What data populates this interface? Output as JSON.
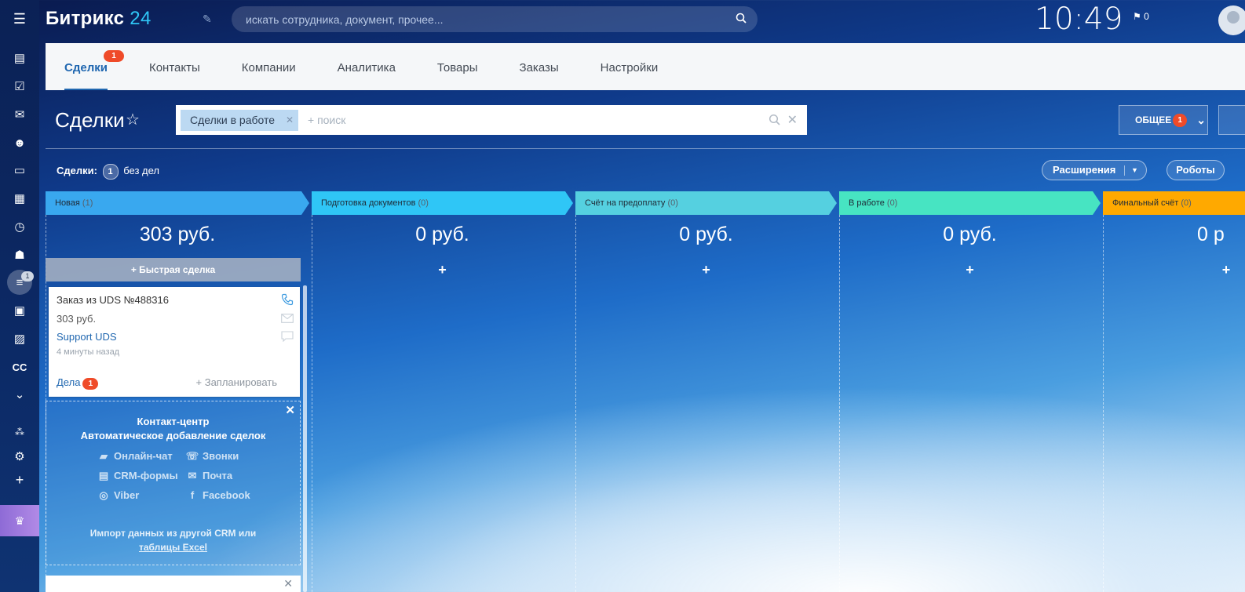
{
  "app": {
    "logo_text": "Битрикс",
    "logo_num": "24"
  },
  "header": {
    "search_placeholder": "искать сотрудника, документ, прочее...",
    "clock": "10:49",
    "notifications": "0"
  },
  "left_rail": {
    "active_badge": "1"
  },
  "tabs": [
    {
      "label": "Сделки",
      "badge": "1"
    },
    {
      "label": "Контакты"
    },
    {
      "label": "Компании"
    },
    {
      "label": "Аналитика"
    },
    {
      "label": "Товары"
    },
    {
      "label": "Заказы"
    },
    {
      "label": "Настройки"
    }
  ],
  "page": {
    "title": "Сделки",
    "filter_chip": "Сделки в работе",
    "filter_add": "+ поиск",
    "general_btn": "ОБЩЕЕ",
    "general_badge": "1",
    "counter_label": "Сделки:",
    "counter_value": "1",
    "counter_text": "без дел",
    "extensions_btn": "Расширения",
    "robots_btn": "Роботы"
  },
  "stages": [
    {
      "name": "Новая",
      "count": "(1)",
      "sum": "303 руб.",
      "color": "#39a8ef"
    },
    {
      "name": "Подготовка документов",
      "count": "(0)",
      "sum": "0 руб.",
      "color": "#2fc6f6"
    },
    {
      "name": "Счёт на предоплату",
      "count": "(0)",
      "sum": "0 руб.",
      "color": "#55d0e0"
    },
    {
      "name": "В работе",
      "count": "(0)",
      "sum": "0 руб.",
      "color": "#47e4c2"
    },
    {
      "name": "Финальный счёт",
      "count": "(0)",
      "sum": "0 р",
      "color": "#ffa900"
    }
  ],
  "quick_deal": "Быстрая сделка",
  "deal": {
    "title": "Заказ из UDS №488316",
    "sum": "303 руб.",
    "client": "Support UDS",
    "time": "4 минуты назад",
    "todo_label": "Дела",
    "todo_badge": "1",
    "plan": "+ Запланировать"
  },
  "promo": {
    "title_line1": "Контакт-центр",
    "title_line2": "Автоматическое добавление сделок",
    "items": [
      "Онлайн-чат",
      "Звонки",
      "CRM-формы",
      "Почта",
      "Viber",
      "Facebook"
    ],
    "import_line1": "Импорт данных из другой CRM или",
    "import_line2": "таблицы Excel"
  }
}
